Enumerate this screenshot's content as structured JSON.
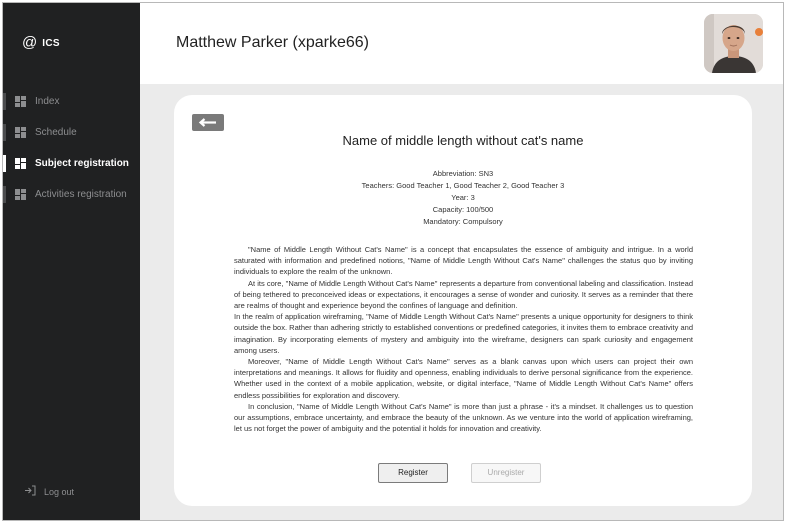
{
  "sidebar": {
    "logo": {
      "symbol": "@",
      "text": "ICS"
    },
    "items": [
      {
        "label": "Index",
        "active": false
      },
      {
        "label": "Schedule",
        "active": false
      },
      {
        "label": "Subject registration",
        "active": true
      },
      {
        "label": "Activities registration",
        "active": false
      }
    ],
    "logout_label": "Log out"
  },
  "header": {
    "user_name": "Matthew Parker (xparke66)"
  },
  "subject": {
    "title": "Name of middle length without cat's name",
    "abbreviation": "Abbreviation: SN3",
    "teachers": "Teachers: Good Teacher 1, Good Teacher 2, Good Teacher 3",
    "year": "Year: 3",
    "capacity": "Capacity: 100/500",
    "mandatory": "Mandatory: Compulsory",
    "description": [
      "\"Name of Middle Length Without Cat's Name\" is a concept that encapsulates the essence of ambiguity and intrigue. In a world saturated with information and predefined notions, \"Name of Middle Length Without Cat's Name\" challenges the status quo by inviting individuals to explore the realm of the unknown.",
      "At its core, \"Name of Middle Length Without Cat's Name\" represents a departure from conventional labeling and classification. Instead of being tethered to preconceived ideas or expectations, it encourages a sense of wonder and curiosity. It serves as a reminder that there are realms of thought and experience beyond the confines of language and definition.",
      "In the realm of application wireframing, \"Name of Middle Length Without Cat's Name\" presents a unique opportunity for designers to think outside the box. Rather than adhering strictly to established conventions or predefined categories, it invites them to embrace creativity and imagination. By incorporating elements of mystery and ambiguity into the wireframe, designers can spark curiosity and engagement among users.",
      "Moreover, \"Name of Middle Length Without Cat's Name\" serves as a blank canvas upon which users can project their own interpretations and meanings. It allows for fluidity and openness, enabling individuals to derive personal significance from the experience. Whether used in the context of a mobile application, website, or digital interface, \"Name of Middle Length Without Cat's Name\" offers endless possibilities for exploration and discovery.",
      "In conclusion, \"Name of Middle Length Without Cat's Name\" is more than just a phrase - it's a mindset. It challenges us to question our assumptions, embrace uncertainty, and embrace the beauty of the unknown. As we venture into the world of application wireframing, let us not forget the power of ambiguity and the potential it holds for innovation and creativity."
    ]
  },
  "actions": {
    "register_label": "Register",
    "unregister_label": "Unregister"
  },
  "colors": {
    "sidebar_bg": "#202122",
    "page_bg": "#ebebeb",
    "card_bg": "#ffffff",
    "active_text": "#ffffff",
    "inactive_text": "#8d8e90"
  }
}
